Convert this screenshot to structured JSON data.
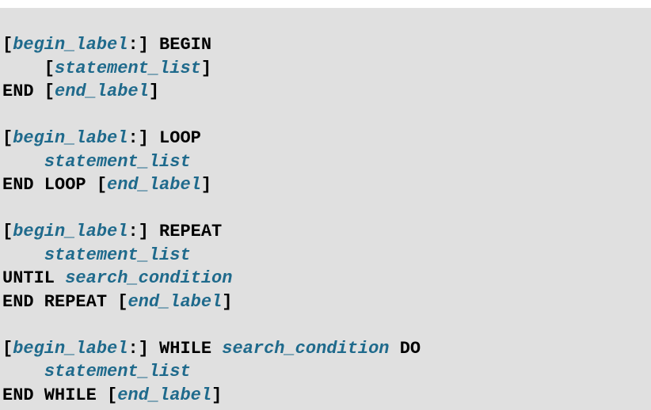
{
  "lines": [
    [
      {
        "t": "[",
        "c": "kw"
      },
      {
        "t": "begin_label",
        "c": "ph"
      },
      {
        "t": ":] BEGIN",
        "c": "kw"
      }
    ],
    [
      {
        "t": "    [",
        "c": "kw"
      },
      {
        "t": "statement_list",
        "c": "ph"
      },
      {
        "t": "]",
        "c": "kw"
      }
    ],
    [
      {
        "t": "END [",
        "c": "kw"
      },
      {
        "t": "end_label",
        "c": "ph"
      },
      {
        "t": "]",
        "c": "kw"
      }
    ],
    [],
    [
      {
        "t": "[",
        "c": "kw"
      },
      {
        "t": "begin_label",
        "c": "ph"
      },
      {
        "t": ":] LOOP",
        "c": "kw"
      }
    ],
    [
      {
        "t": "    ",
        "c": "kw"
      },
      {
        "t": "statement_list",
        "c": "ph"
      }
    ],
    [
      {
        "t": "END LOOP [",
        "c": "kw"
      },
      {
        "t": "end_label",
        "c": "ph"
      },
      {
        "t": "]",
        "c": "kw"
      }
    ],
    [],
    [
      {
        "t": "[",
        "c": "kw"
      },
      {
        "t": "begin_label",
        "c": "ph"
      },
      {
        "t": ":] REPEAT",
        "c": "kw"
      }
    ],
    [
      {
        "t": "    ",
        "c": "kw"
      },
      {
        "t": "statement_list",
        "c": "ph"
      }
    ],
    [
      {
        "t": "UNTIL ",
        "c": "kw"
      },
      {
        "t": "search_condition",
        "c": "ph"
      }
    ],
    [
      {
        "t": "END REPEAT [",
        "c": "kw"
      },
      {
        "t": "end_label",
        "c": "ph"
      },
      {
        "t": "]",
        "c": "kw"
      }
    ],
    [],
    [
      {
        "t": "[",
        "c": "kw"
      },
      {
        "t": "begin_label",
        "c": "ph"
      },
      {
        "t": ":] WHILE ",
        "c": "kw"
      },
      {
        "t": "search_condition",
        "c": "ph"
      },
      {
        "t": " DO",
        "c": "kw"
      }
    ],
    [
      {
        "t": "    ",
        "c": "kw"
      },
      {
        "t": "statement_list",
        "c": "ph"
      }
    ],
    [
      {
        "t": "END WHILE [",
        "c": "kw"
      },
      {
        "t": "end_label",
        "c": "ph"
      },
      {
        "t": "]",
        "c": "kw"
      }
    ]
  ],
  "colors": {
    "background": "#e0e0e0",
    "keyword": "#000000",
    "placeholder": "#1f6a8c"
  }
}
